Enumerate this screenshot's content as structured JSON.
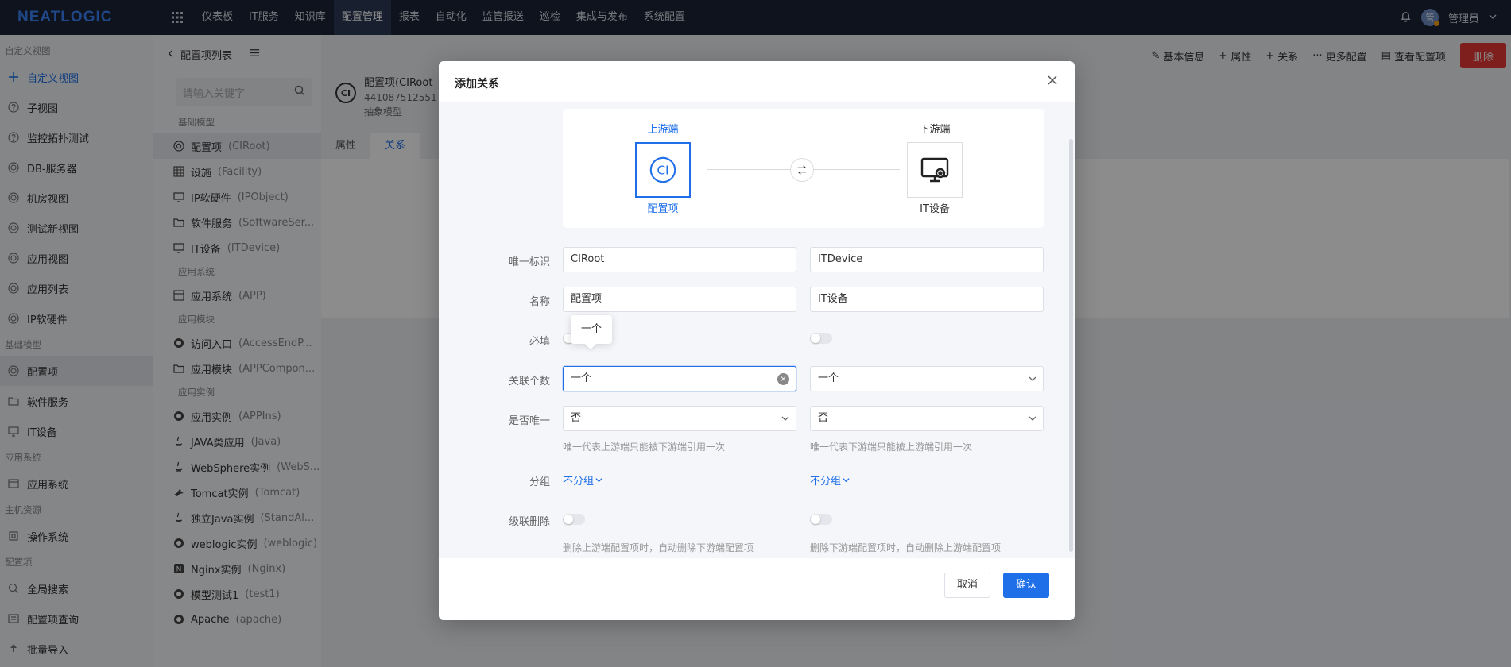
{
  "topbar": {
    "logo": "NEATLOGIC",
    "nav": [
      "仪表板",
      "IT服务",
      "知识库",
      "配置管理",
      "报表",
      "自动化",
      "监管报送",
      "巡检",
      "集成与发布",
      "系统配置"
    ],
    "active_nav": "配置管理",
    "user": "管理员",
    "avatar_text": "管"
  },
  "sidebar": {
    "groups": [
      {
        "title": "自定义视图",
        "items": [
          {
            "label": "自定义视图",
            "icon": "plus-icon",
            "blue": true
          },
          {
            "label": "子视图",
            "icon": "question-circle-icon"
          },
          {
            "label": "监控拓扑测试",
            "icon": "question-circle-icon"
          },
          {
            "label": "DB-服务器",
            "icon": "target-icon"
          },
          {
            "label": "机房视图",
            "icon": "target-icon"
          },
          {
            "label": "测试新视图",
            "icon": "target-icon"
          },
          {
            "label": "应用视图",
            "icon": "target-icon"
          },
          {
            "label": "应用列表",
            "icon": "target-icon"
          },
          {
            "label": "IP软硬件",
            "icon": "target-icon"
          }
        ]
      },
      {
        "title": "基础模型",
        "items": [
          {
            "label": "配置项",
            "icon": "target-icon",
            "active": true
          },
          {
            "label": "软件服务",
            "icon": "folder-icon"
          },
          {
            "label": "IT设备",
            "icon": "monitor-icon"
          }
        ]
      },
      {
        "title": "应用系统",
        "items": [
          {
            "label": "应用系统",
            "icon": "app-icon"
          }
        ]
      },
      {
        "title": "主机资源",
        "items": [
          {
            "label": "操作系统",
            "icon": "os-icon"
          }
        ]
      },
      {
        "title": "配置项",
        "items": [
          {
            "label": "全局搜索",
            "icon": "search-icon"
          },
          {
            "label": "配置项查询",
            "icon": "list-icon"
          },
          {
            "label": "批量导入",
            "icon": "upload-icon"
          }
        ]
      }
    ]
  },
  "tree": {
    "back_label": "配置项列表",
    "search_placeholder": "请输入关键字",
    "groups": [
      {
        "title": "基础模型",
        "items": [
          {
            "name": "配置项",
            "sub": "(CIRoot)",
            "active": true
          },
          {
            "name": "设施",
            "sub": "(Facility)"
          },
          {
            "name": "IP软硬件",
            "sub": "(IPObject)"
          },
          {
            "name": "软件服务",
            "sub": "(SoftwareSer..."
          },
          {
            "name": "IT设备",
            "sub": "(ITDevice)"
          }
        ]
      },
      {
        "title": "应用系统",
        "items": [
          {
            "name": "应用系统",
            "sub": "(APP)"
          }
        ]
      },
      {
        "title": "应用模块",
        "items": [
          {
            "name": "访问入口",
            "sub": "(AccessEndP..."
          },
          {
            "name": "应用模块",
            "sub": "(APPCompon..."
          }
        ]
      },
      {
        "title": "应用实例",
        "items": [
          {
            "name": "应用实例",
            "sub": "(APPIns)"
          },
          {
            "name": "JAVA类应用",
            "sub": "(Java)"
          },
          {
            "name": "WebSphere实例",
            "sub": "(WebS..."
          },
          {
            "name": "Tomcat实例",
            "sub": "(Tomcat)"
          },
          {
            "name": "独立Java实例",
            "sub": "(StandAl..."
          },
          {
            "name": "weblogic实例",
            "sub": "(weblogic)"
          },
          {
            "name": "Nginx实例",
            "sub": "(Nginx)"
          },
          {
            "name": "模型测试1",
            "sub": "(test1)"
          },
          {
            "name": "Apache",
            "sub": "(apache)"
          }
        ]
      }
    ]
  },
  "main": {
    "toolbar": [
      "基本信息",
      "属性",
      "关系",
      "更多配置",
      "查看配置项"
    ],
    "delete_label": "删除",
    "ci_title": "配置项(CIRoot",
    "ci_id": "441087512551",
    "ci_type": "抽象模型",
    "tabs": [
      "属性",
      "关系"
    ],
    "active_tab": "关系"
  },
  "dialog": {
    "title": "添加关系",
    "upstream_label": "上游端",
    "downstream_label": "下游端",
    "upstream_name": "配置项",
    "downstream_name": "IT设备",
    "labels": {
      "unique_id": "唯一标识",
      "name": "名称",
      "required": "必填",
      "count": "关联个数",
      "is_unique": "是否唯一",
      "group": "分组",
      "cascade_delete": "级联删除"
    },
    "left": {
      "unique_id": "CIRoot",
      "name": "配置项",
      "count": "一个",
      "is_unique": "否",
      "unique_hint": "唯一代表上游端只能被下游端引用一次",
      "group": "不分组",
      "cascade_hint": "删除上游端配置项时，自动删除下游端配置项"
    },
    "right": {
      "unique_id": "ITDevice",
      "name": "IT设备",
      "count": "一个",
      "is_unique": "否",
      "unique_hint": "唯一代表下游端只能被上游端引用一次",
      "group": "不分组",
      "cascade_hint": "删除下游端配置项时，自动删除上游端配置项"
    },
    "tooltip": "一个",
    "cancel_label": "取消",
    "ok_label": "确认"
  },
  "colors": {
    "accent": "#1e6fe8",
    "topbar": "#1b2336",
    "danger": "#e53935"
  }
}
